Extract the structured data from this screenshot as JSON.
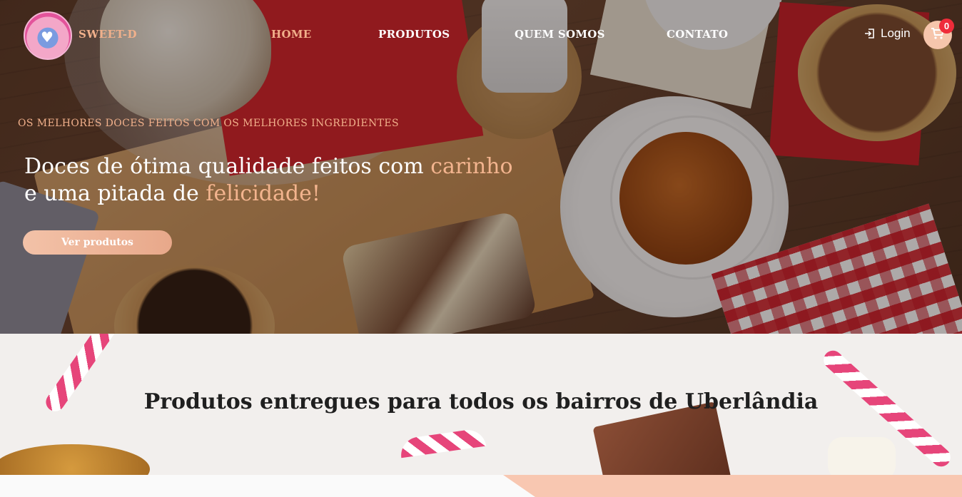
{
  "header": {
    "brand": "SWEET-D",
    "nav": [
      {
        "label": "HOME"
      },
      {
        "label": "PRODUTOS"
      },
      {
        "label": "QUEM SOMOS"
      },
      {
        "label": "CONTATO"
      }
    ],
    "login_label": "Login",
    "cart_count": "0"
  },
  "hero": {
    "eyebrow": "OS MELHORES DOCES FEITOS COM OS MELHORES INGREDIENTES",
    "headline_part1": "Doces de ótima qualidade feitos com ",
    "headline_accent1": "carinho",
    "headline_part2": "e uma pitada de ",
    "headline_accent2": "felicidade!",
    "cta_label": "Ver produtos"
  },
  "delivery": {
    "title": "Produtos entregues para todos os bairros de Uberlândia"
  },
  "icons": {
    "login": "login-icon",
    "cart": "cart-icon"
  },
  "colors": {
    "accent": "#f1b08b",
    "cta": "#e8a88a",
    "badge": "#ef2c3a",
    "cart_bg": "#f6c6ac",
    "footer_accent": "#f8c7b1"
  }
}
